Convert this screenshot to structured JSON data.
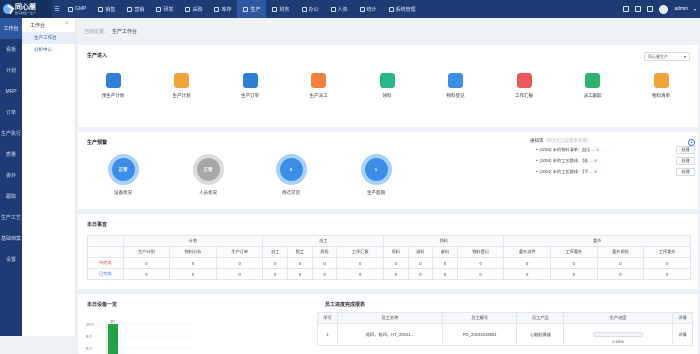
{
  "app": {
    "logo_title": "同心雁",
    "logo_subtitle": "数字制造一生产"
  },
  "topnav": [
    {
      "label": "GMP",
      "icon": "gmp-icon"
    },
    {
      "label": "销售",
      "icon": "sales-icon"
    },
    {
      "label": "营销",
      "icon": "marketing-icon"
    },
    {
      "label": "研发",
      "icon": "rnd-icon"
    },
    {
      "label": "采购",
      "icon": "purchase-icon"
    },
    {
      "label": "库存",
      "icon": "inventory-icon"
    },
    {
      "label": "生产",
      "icon": "production-icon",
      "active": true
    },
    {
      "label": "财务",
      "icon": "finance-icon"
    },
    {
      "label": "办公",
      "icon": "office-icon"
    },
    {
      "label": "人资",
      "icon": "hr-icon"
    },
    {
      "label": "统计",
      "icon": "stats-icon"
    },
    {
      "label": "系统管理",
      "icon": "system-icon"
    }
  ],
  "user": {
    "name": "admin"
  },
  "sidebar": [
    {
      "label": "工作台",
      "active": true
    },
    {
      "label": "看板"
    },
    {
      "label": "计划"
    },
    {
      "label": "MRP"
    },
    {
      "label": "订单"
    },
    {
      "label": "生产执行"
    },
    {
      "label": "质量"
    },
    {
      "label": "委外"
    },
    {
      "label": "跟踪"
    },
    {
      "label": "生产工艺"
    },
    {
      "label": "基础档案"
    },
    {
      "label": "设置"
    }
  ],
  "subside": {
    "header": "工作台",
    "items": [
      {
        "label": "生产工作台",
        "active": true
      },
      {
        "label": "分析中心"
      }
    ]
  },
  "breadcrumb": {
    "prefix": "当前位置：",
    "current": "生产工作台"
  },
  "shortcuts": {
    "title": "生产进入",
    "select_value": "同心雁生产",
    "items": [
      {
        "label": "预生产计划",
        "color": "#2f7fd8"
      },
      {
        "label": "生产计划",
        "color": "#f0a23a"
      },
      {
        "label": "生产订单",
        "color": "#2f7fd8"
      },
      {
        "label": "生产派工",
        "color": "#f0803a"
      },
      {
        "label": "领料",
        "color": "#28b68a"
      },
      {
        "label": "物料登记",
        "color": "#3a8fe0"
      },
      {
        "label": "工作汇报",
        "color": "#e85a5a"
      },
      {
        "label": "派工跟踪",
        "color": "#2fb36a"
      },
      {
        "label": "物料清单",
        "color": "#f0a23a"
      }
    ]
  },
  "warning": {
    "title": "生产预警",
    "gauges": [
      {
        "label": "设备状况",
        "value": "正常",
        "color": "#3d8ee8",
        "ring": "#a9d0f7"
      },
      {
        "label": "人员状况",
        "value": "正常",
        "color": "#a7a7a7",
        "ring": "#dcdcdc"
      },
      {
        "label": "待迁交货",
        "value": "0",
        "color": "#3d8ee8",
        "ring": "#a9d0f7"
      },
      {
        "label": "生产超期",
        "value": "1",
        "color": "#3d8ee8",
        "ring": "#a9d0f7"
      }
    ],
    "notice_title": "通知等",
    "notice_tip": "待出处已设置系统期：",
    "notices": [
      {
        "text": "(1024) 未的物料清单：血压...",
        "btn": "处理"
      },
      {
        "text": "(1004) 未的工艺路线：【处...",
        "btn": "处理"
      },
      {
        "text": "(1004) 未的工艺路线：【手...",
        "btn": "处理"
      }
    ]
  },
  "summary": {
    "title": "本日事宜",
    "groups": [
      {
        "label": "计划",
        "cols": [
          "生产计划",
          "物料分析",
          "生产订单"
        ]
      },
      {
        "label": "派工",
        "cols": [
          "派工",
          "报工",
          "质检",
          "工序汇报"
        ]
      },
      {
        "label": "领料",
        "cols": [
          "领料",
          "退料",
          "废料",
          "物料登记"
        ]
      },
      {
        "label": "委外",
        "cols": [
          "委外派件",
          "工序委外",
          "委外质检",
          "工序委外"
        ]
      }
    ],
    "rows": [
      {
        "label": "待完成",
        "values": [
          "0",
          "0",
          "0",
          "0",
          "0",
          "0",
          "0",
          "0",
          "0",
          "0",
          "0",
          "0",
          "0",
          "0",
          "0"
        ]
      },
      {
        "label": "已完成",
        "values": [
          "0",
          "0",
          "0",
          "0",
          "0",
          "0",
          "0",
          "0",
          "0",
          "0",
          "0",
          "0",
          "0",
          "0",
          "0"
        ]
      }
    ]
  },
  "device_chart": {
    "title": "本日设备一览",
    "chart_data": {
      "type": "bar",
      "categories": [
        ""
      ],
      "values": [
        10
      ],
      "ylim": [
        0,
        10
      ],
      "yticks": [
        "10.0",
        "8.0",
        "6.0"
      ],
      "data_label": "10"
    }
  },
  "progress": {
    "title": "员工进度完成报表",
    "headers": [
      "序号",
      "员工名称",
      "员工编号",
      "员工产品",
      "生产进度",
      "详情"
    ],
    "rows": [
      {
        "no": "1",
        "name": "裕四，裕四，HT_20241...",
        "code": "PG_20241019001",
        "product": "心脑起搏器",
        "progress": 0,
        "progress_text": "0.00%",
        "detail": "详情"
      }
    ]
  }
}
